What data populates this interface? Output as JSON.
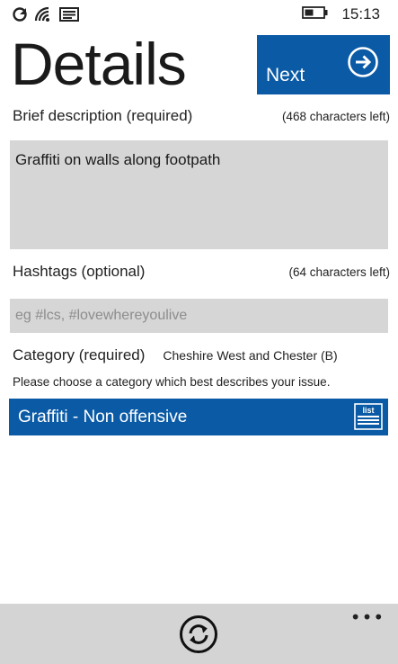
{
  "status_bar": {
    "icons": [
      "data-sync-icon",
      "wifi-icon",
      "message-icon",
      "battery-icon"
    ],
    "time": "15:13"
  },
  "page": {
    "title": "Details"
  },
  "next_button": {
    "label": "Next",
    "icon": "arrow-right-circle-icon"
  },
  "description": {
    "label": "Brief description (required)",
    "chars_left": "(468 characters left)",
    "value": "Graffiti on walls along footpath"
  },
  "hashtags": {
    "label": "Hashtags (optional)",
    "chars_left": "(64 characters left)",
    "placeholder": "eg #lcs, #lovewhereyoulive",
    "value": ""
  },
  "category": {
    "label": "Category (required)",
    "council": "Cheshire West and Chester (B)",
    "hint": "Please choose a category which best describes your issue.",
    "selected": "Graffiti - Non offensive",
    "list_icon_text": "list"
  },
  "app_bar": {
    "refresh_icon": "refresh-icon",
    "more_label": "•••"
  },
  "colors": {
    "accent": "#0a5aa5",
    "field_bg": "#d6d6d6",
    "app_bar_bg": "#d4d4d4"
  }
}
